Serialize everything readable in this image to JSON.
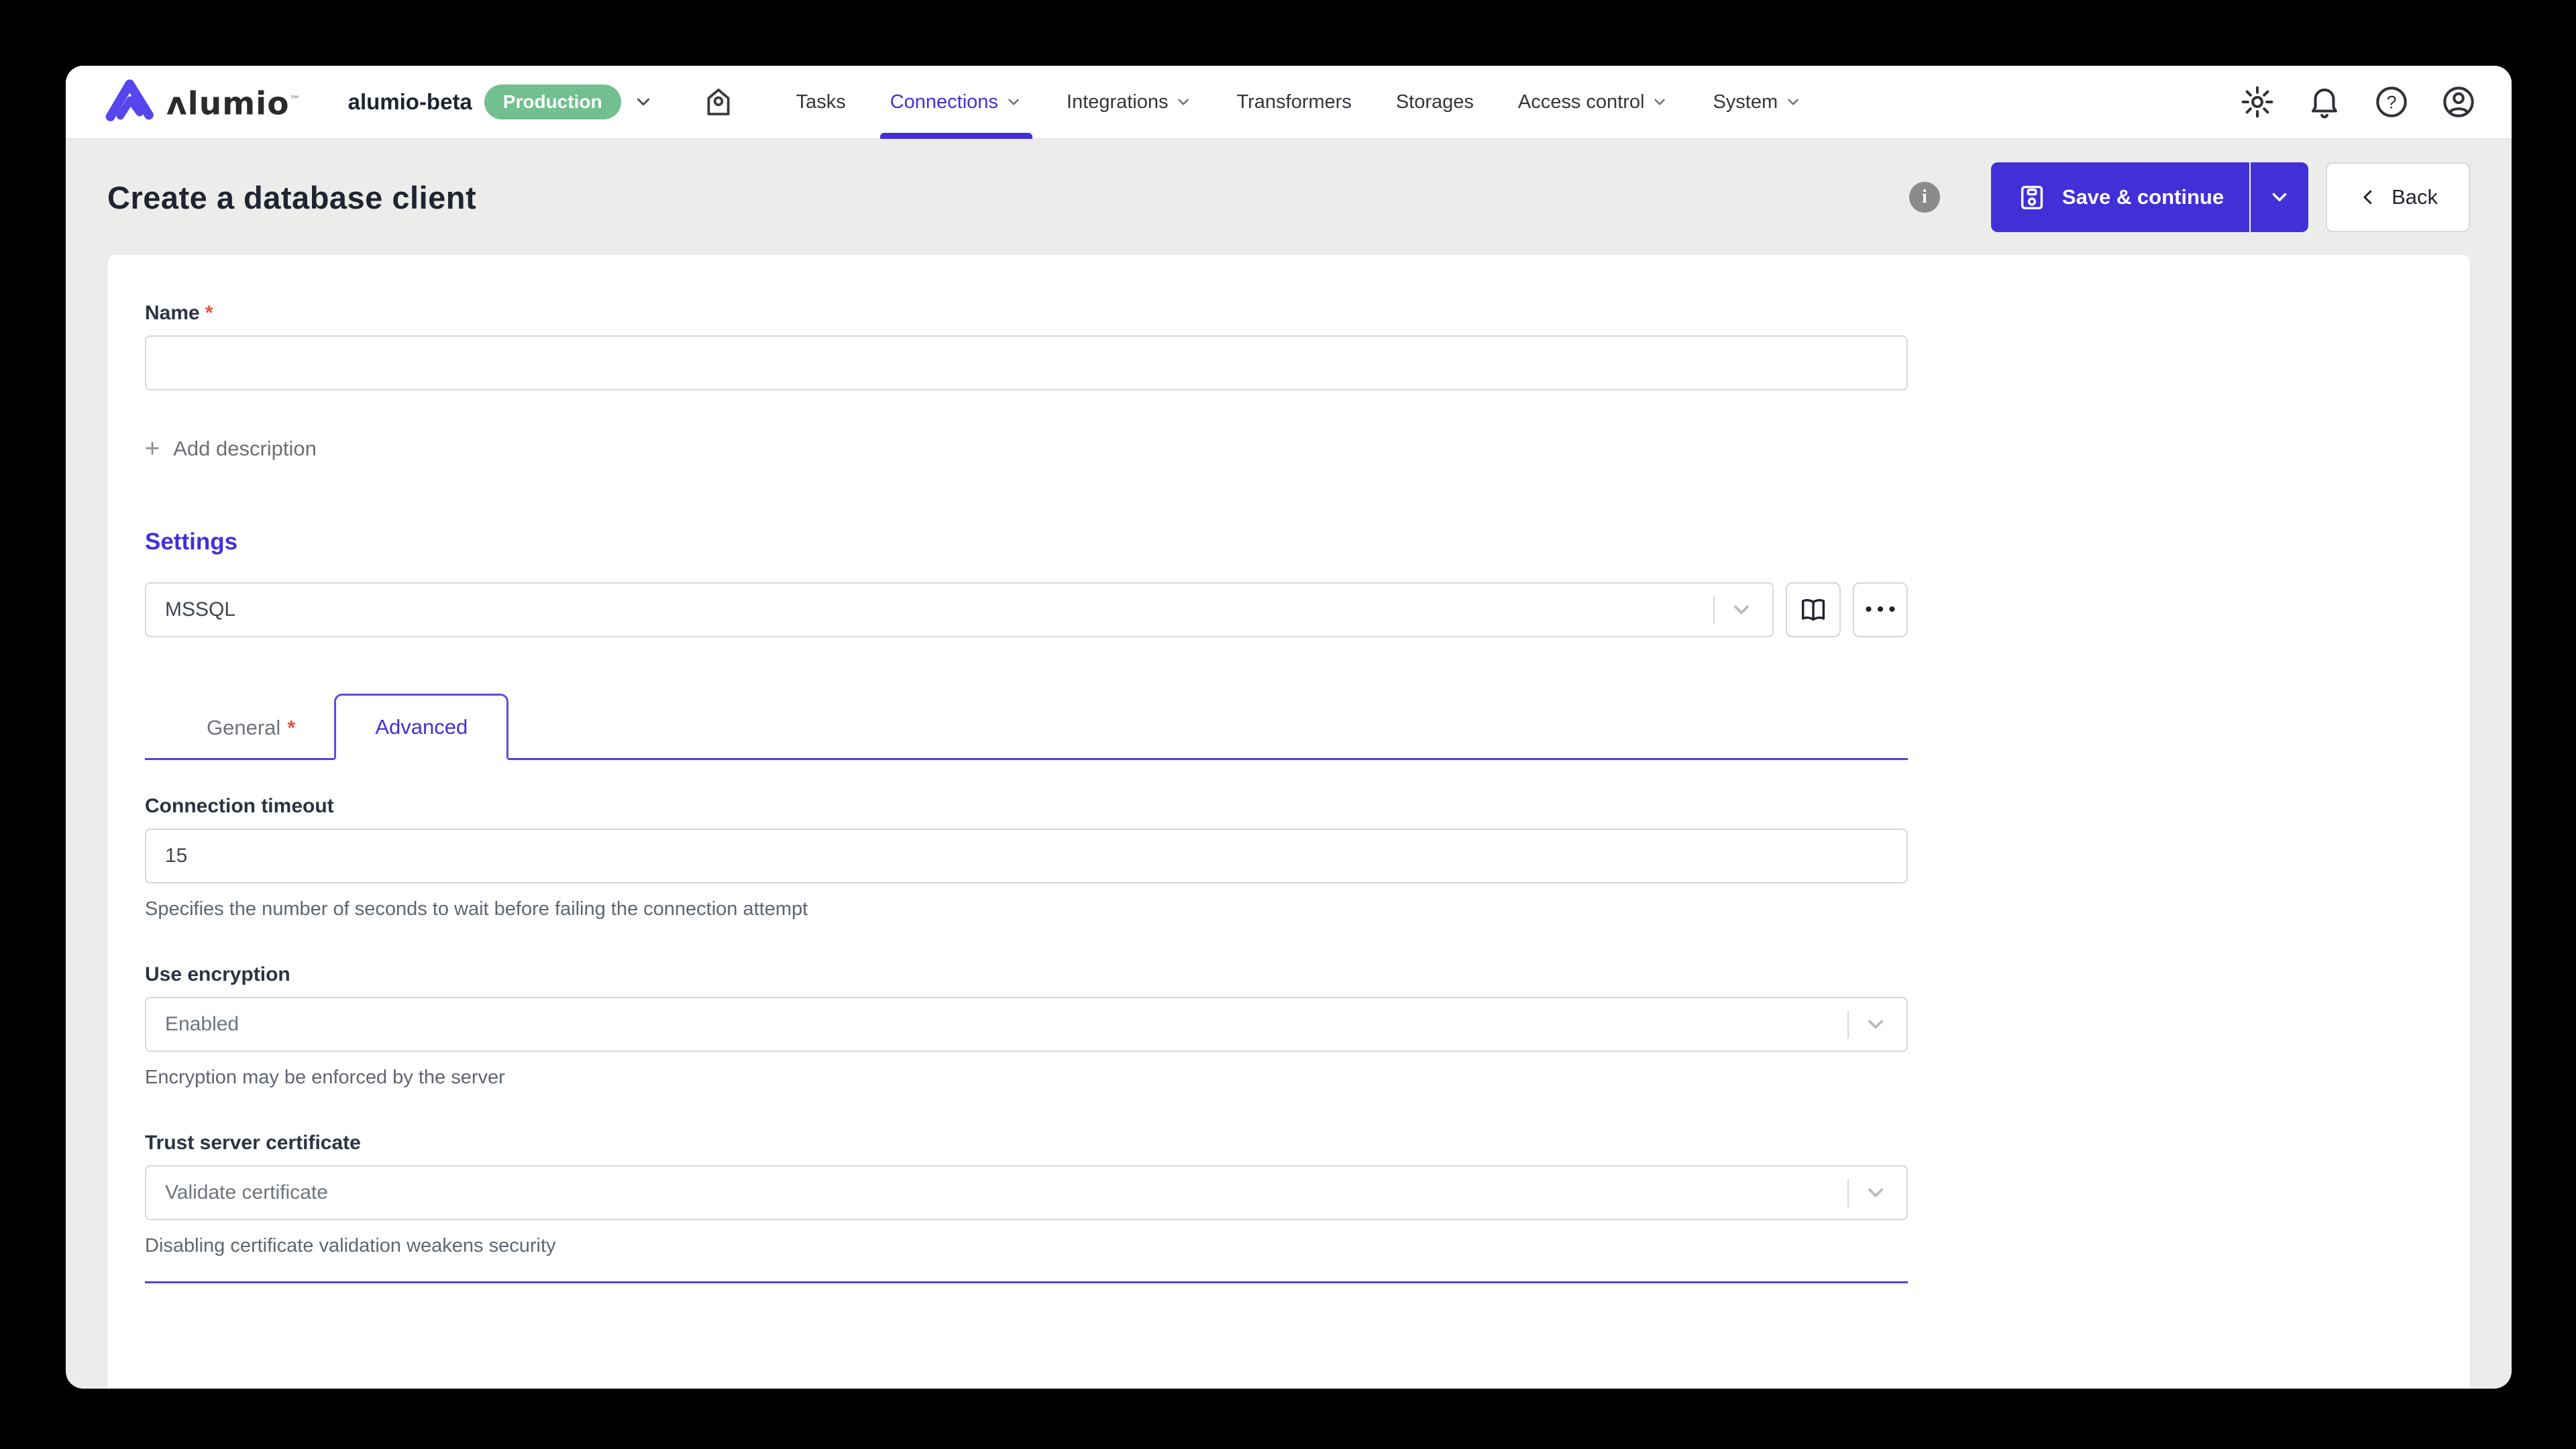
{
  "header": {
    "logo_text": "ʌlumio",
    "logo_tm": "™",
    "environment": {
      "name": "alumio-beta",
      "badge": "Production"
    },
    "nav": [
      {
        "label": "Tasks"
      },
      {
        "label": "Connections"
      },
      {
        "label": "Integrations"
      },
      {
        "label": "Transformers"
      },
      {
        "label": "Storages"
      },
      {
        "label": "Access control"
      },
      {
        "label": "System"
      }
    ]
  },
  "page": {
    "title": "Create a database client",
    "save_label": "Save & continue",
    "back_label": "Back"
  },
  "form": {
    "name": {
      "label": "Name",
      "required": "*",
      "value": ""
    },
    "add_description": "Add description",
    "settings_heading": "Settings",
    "client_select": {
      "value": "MSSQL"
    },
    "ellipsis": "•••",
    "plus": "+",
    "info": "i",
    "tabs": {
      "general": {
        "label": "General",
        "required": "*"
      },
      "advanced": {
        "label": "Advanced"
      }
    },
    "fields": [
      {
        "label": "Connection timeout",
        "value": "15",
        "helper": "Specifies the number of seconds to wait before failing the connection attempt"
      },
      {
        "label": "Use encryption",
        "value": "Enabled",
        "helper": "Encryption may be enforced by the server"
      },
      {
        "label": "Trust server certificate",
        "value": "Validate certificate",
        "helper": "Disabling certificate validation weakens security"
      }
    ]
  },
  "colors": {
    "primary": "#4130d8",
    "logo_purple": "#5646ee",
    "badge_green": "#72bf8f",
    "required_red": "#e2563f",
    "page_bg": "#ececea"
  }
}
